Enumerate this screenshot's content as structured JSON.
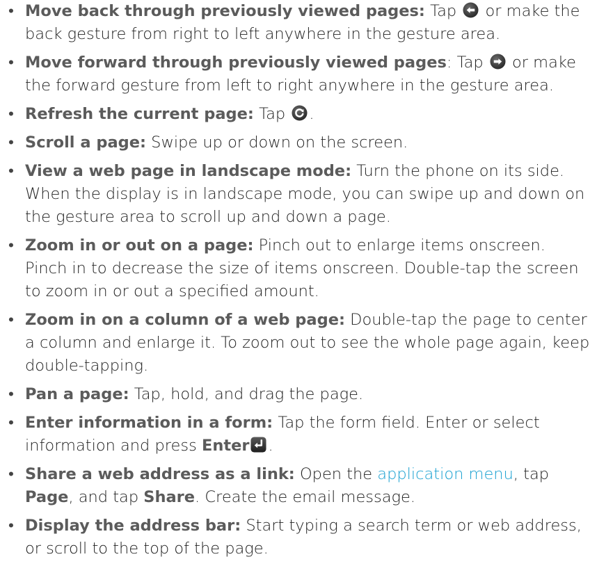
{
  "items": [
    {
      "term": "Move back through previously viewed pages:",
      "before": " Tap ",
      "after": " or make the back gesture from right to left anywhere in the gesture area.",
      "icon": "back-arrow-icon"
    },
    {
      "term": "Move forward through previously viewed pages",
      "before": ": Tap ",
      "after": " or make the forward gesture from left to right anywhere in the gesture area.",
      "icon": "forward-arrow-icon"
    },
    {
      "term": "Refresh the current page:",
      "before": " Tap ",
      "after": ".",
      "icon": "refresh-icon"
    },
    {
      "term": "Scroll a page:",
      "text": " Swipe up or down on the screen."
    },
    {
      "term": "View a web page in landscape mode:",
      "text": " Turn the phone on its side. When the display is in landscape mode, you can swipe up and down on the gesture area to scroll up and down a page."
    },
    {
      "term": "Zoom in or out on a page:",
      "text": " Pinch out to enlarge items onscreen. Pinch in to decrease the size of items onscreen. Double-tap the screen to zoom in or out a specified amount."
    },
    {
      "term": "Zoom in on a column of a web page:",
      "text": " Double-tap the page to center a column and enlarge it. To zoom out to see the whole page again, keep double-tapping."
    },
    {
      "term": "Pan a page:",
      "text": " Tap, hold, and drag the page."
    },
    {
      "term": "Enter information in a form:",
      "before": " Tap the form field. Enter or select information and press ",
      "strong": "Enter",
      "after": ".",
      "icon": "enter-key-icon"
    },
    {
      "term": "Share a web address as a link:",
      "t1": " Open the ",
      "link": "application menu",
      "t2": ", tap ",
      "s1": "Page",
      "t3": ", and tap ",
      "s2": "Share",
      "t4": ". Create the email message."
    },
    {
      "term": "Display the address bar:",
      "text": " Start typing a search term or web address, or scroll to the top of the page."
    }
  ],
  "bullet": "•",
  "colors": {
    "link": "#1aa1d1",
    "term": "#5b5b5b",
    "icon_dark": "#3a3a3a"
  }
}
